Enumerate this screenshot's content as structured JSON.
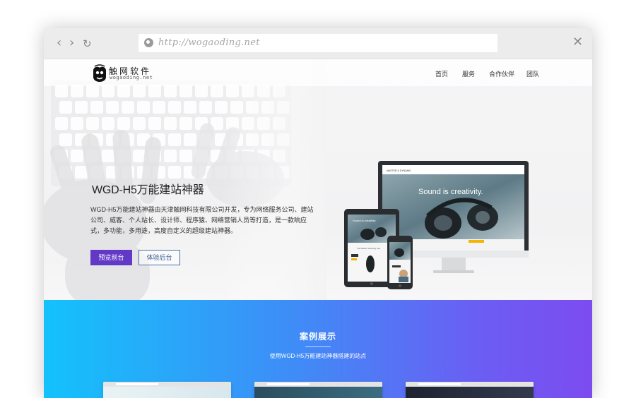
{
  "browser": {
    "back_icon": "chevron-left-icon",
    "forward_icon": "chevron-right-icon",
    "reload_icon": "reload-icon",
    "url": "http://wogaoding.net",
    "close_icon": "close-icon"
  },
  "site": {
    "logo_name": "触网软件",
    "logo_domain": "wogaoding.net",
    "nav": [
      "首页",
      "服务",
      "合作伙伴",
      "团队"
    ]
  },
  "hero": {
    "title": "WGD-H5万能建站神器",
    "description": "WGD-H5万能建站神器由天津触网科技有限公司开发，专为网络服务公司、建站公司、威客、个人站长、设计师、程序猿、网络营销人员等打造，是一款响应式，多功能，多用途，高度自定义的超级建站神器。",
    "primary_button": "预览前台",
    "secondary_button": "体验后台"
  },
  "mockup": {
    "monitor_brand": "MASTER & DYNAMIC",
    "monitor_headline": "Sound is creativity.",
    "tablet_headline": "Sound is creativity",
    "tablet_caption": "The Modern Listening Cap",
    "phone_headline": "Sound is creativity"
  },
  "showcase": {
    "title": "案例展示",
    "subtitle": "使用WGD-H5万能建站神器搭建的站点"
  },
  "colors": {
    "primary_button": "#6238c6",
    "outline_button": "#4a6fa5",
    "showcase_start": "#13c2fb",
    "showcase_end": "#7c4cf0"
  }
}
